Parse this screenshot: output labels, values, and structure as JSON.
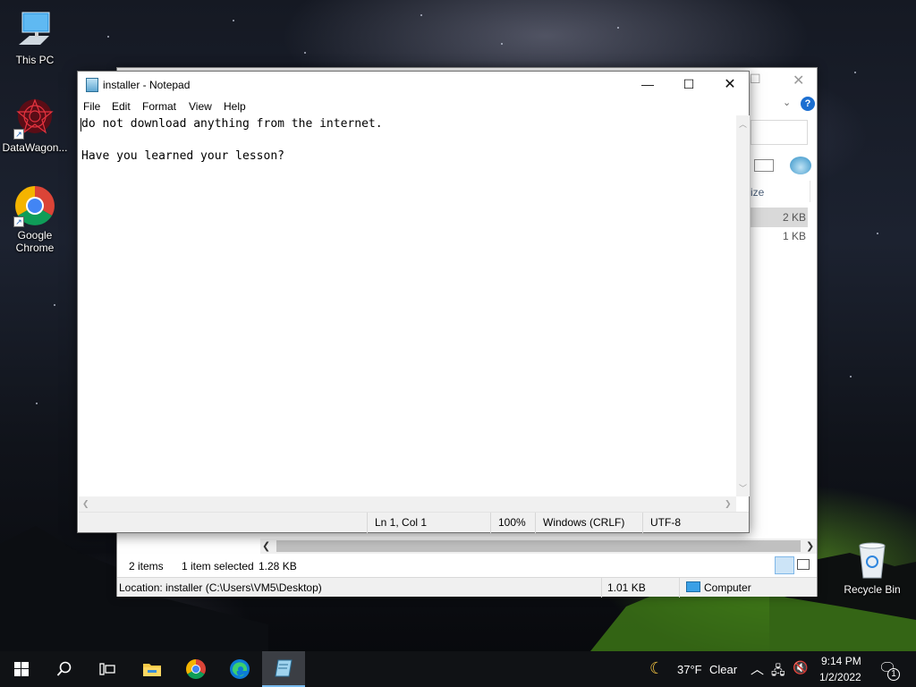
{
  "desktop": {
    "icons": [
      {
        "label": "This PC",
        "icon": "this-pc-icon"
      },
      {
        "label": "DataWagon...",
        "icon": "datawagon-icon"
      },
      {
        "label": "Google Chrome",
        "icon": "chrome-icon"
      },
      {
        "label": "Recycle Bin",
        "icon": "recycle-bin-icon"
      }
    ]
  },
  "explorer": {
    "column_header_partial": "ize",
    "file_sizes": [
      "2 KB",
      "1 KB"
    ],
    "status_items_count": "2 items",
    "status_selected": "1 item selected",
    "status_selected_size": "1.28 KB",
    "location": "Location: installer (C:\\Users\\VM5\\Desktop)",
    "location_size": "1.01 KB",
    "location_zone": "Computer"
  },
  "notepad": {
    "title": "installer - Notepad",
    "menu": [
      "File",
      "Edit",
      "Format",
      "View",
      "Help"
    ],
    "content": "do not download anything from the internet.\n\nHave you learned your lesson?",
    "status": {
      "position": "Ln 1, Col 1",
      "zoom": "100%",
      "line_ending": "Windows (CRLF)",
      "encoding": "UTF-8"
    }
  },
  "taskbar": {
    "apps": [
      "start-icon",
      "search-icon",
      "task-view-icon",
      "file-explorer-icon",
      "chrome-icon",
      "edge-icon",
      "notepad-icon"
    ],
    "weather_temp": "37°F",
    "weather_desc": "Clear",
    "time": "9:14 PM",
    "date": "1/2/2022",
    "notification_count": "1"
  },
  "colors": {
    "accent": "#0078d7",
    "taskbar": "#101215",
    "chrome_red": "#db4437",
    "chrome_green": "#0f9d58",
    "chrome_yellow": "#f4b400",
    "chrome_blue": "#4285f4"
  }
}
